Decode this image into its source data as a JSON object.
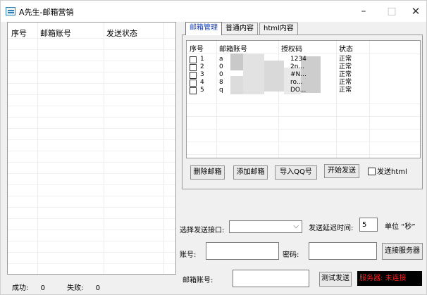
{
  "window": {
    "title": "A先生-邮箱营销",
    "minimize": "–",
    "maximize": "□",
    "close": "✕"
  },
  "left_list": {
    "headers": [
      "序号",
      "邮箱账号",
      "发送状态"
    ]
  },
  "footer": {
    "success_label": "成功:",
    "success_count": "0",
    "fail_label": "失败:",
    "fail_count": "0"
  },
  "tabs": [
    "邮箱管理",
    "普通内容",
    "html内容"
  ],
  "email_table": {
    "headers": [
      "序号",
      "邮箱账号",
      "授权码",
      "状态"
    ],
    "rows": [
      {
        "num": "1",
        "account": "a",
        "auth": "1234",
        "status": "正常",
        "checked": false
      },
      {
        "num": "2",
        "account": "0",
        "auth": "2n...",
        "status": "正常",
        "checked": false
      },
      {
        "num": "3",
        "account": "0",
        "auth": "#N...",
        "status": "正常",
        "checked": false
      },
      {
        "num": "4",
        "account": "8",
        "auth": "ro...",
        "status": "正常",
        "checked": false
      },
      {
        "num": "5",
        "account": "q",
        "auth": "DO...",
        "status": "正常",
        "checked": false
      }
    ]
  },
  "actions": {
    "delete": "删除邮箱",
    "add": "添加邮箱",
    "import_qq": "导入QQ号",
    "start": "开始发送",
    "send_html": "发送html"
  },
  "form": {
    "interface_label": "选择发送接口:",
    "interface_value": "",
    "delay_label": "发送延迟时间:",
    "delay_value": "5",
    "unit_label": "单位 “秒”",
    "account_label": "账号:",
    "account_value": "",
    "password_label": "密码:",
    "password_value": "",
    "connect": "连接服务器",
    "email_label": "邮箱账号:",
    "email_value": "",
    "test_send": "测试发送",
    "server_status": "服务器: 未连接"
  },
  "colors": {
    "active_tab_text": "#1a44b8",
    "server_status_text": "#ff2020",
    "server_status_bg": "#000000"
  }
}
